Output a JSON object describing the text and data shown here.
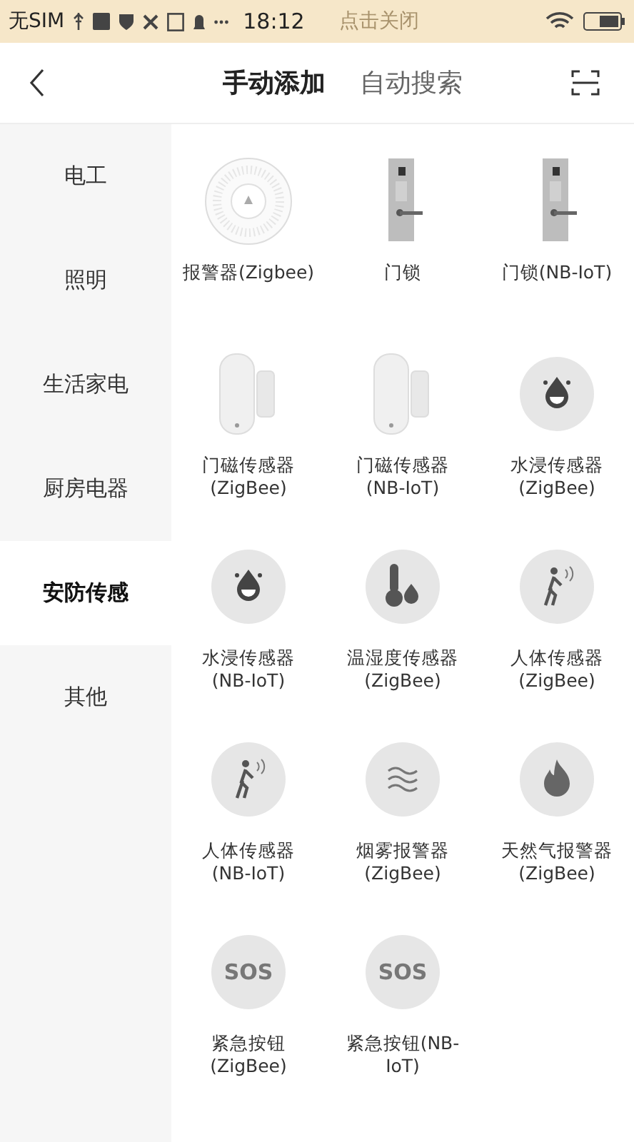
{
  "status_bar": {
    "carrier": "无SIM",
    "time": "18:12",
    "notice": "点击关闭"
  },
  "header": {
    "tabs": [
      {
        "label": "手动添加",
        "selected": true
      },
      {
        "label": "自动搜索",
        "selected": false
      }
    ]
  },
  "sidebar": {
    "items": [
      {
        "label": "电工",
        "selected": false
      },
      {
        "label": "照明",
        "selected": false
      },
      {
        "label": "生活家电",
        "selected": false
      },
      {
        "label": "厨房电器",
        "selected": false
      },
      {
        "label": "安防传感",
        "selected": true
      },
      {
        "label": "其他",
        "selected": false
      }
    ]
  },
  "devices": [
    {
      "name": "报警器(Zigbee)",
      "kind": "alarm"
    },
    {
      "name": "门锁",
      "kind": "lock"
    },
    {
      "name": "门锁(NB-IoT)",
      "kind": "lock"
    },
    {
      "name": "门磁传感器\n(ZigBee)",
      "kind": "door"
    },
    {
      "name": "门磁传感器\n(NB-IoT)",
      "kind": "door"
    },
    {
      "name": "水浸传感器\n(ZigBee)",
      "kind": "water"
    },
    {
      "name": "水浸传感器\n(NB-IoT)",
      "kind": "water"
    },
    {
      "name": "温湿度传感器\n(ZigBee)",
      "kind": "thermo"
    },
    {
      "name": "人体传感器\n(ZigBee)",
      "kind": "motion"
    },
    {
      "name": "人体传感器\n(NB-IoT)",
      "kind": "motion"
    },
    {
      "name": "烟雾报警器\n(ZigBee)",
      "kind": "smoke"
    },
    {
      "name": "天然气报警器\n(ZigBee)",
      "kind": "fire"
    },
    {
      "name": "紧急按钮\n(ZigBee)",
      "kind": "sos",
      "icon_text": "SOS"
    },
    {
      "name": "紧急按钮(NB-\nIoT)",
      "kind": "sos",
      "icon_text": "SOS"
    }
  ]
}
